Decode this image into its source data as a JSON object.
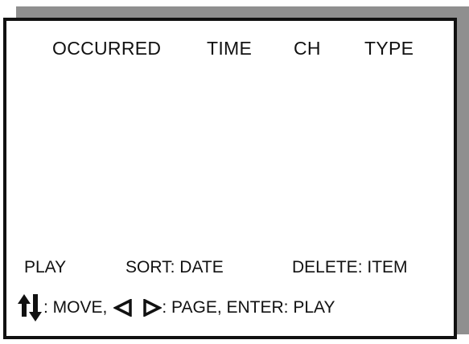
{
  "header": {
    "occurred": "OCCURRED",
    "time": "TIME",
    "ch": "CH",
    "type": "TYPE"
  },
  "actions": {
    "play": "PLAY",
    "sort": "SORT: DATE",
    "delete": "DELETE: ITEM"
  },
  "help": {
    "move_icon": "up-down-arrows-icon",
    "move": ": MOVE,",
    "left_icon": "triangle-left-icon",
    "right_icon": "triangle-right-icon",
    "page_enter": ": PAGE, ENTER: PLAY"
  }
}
